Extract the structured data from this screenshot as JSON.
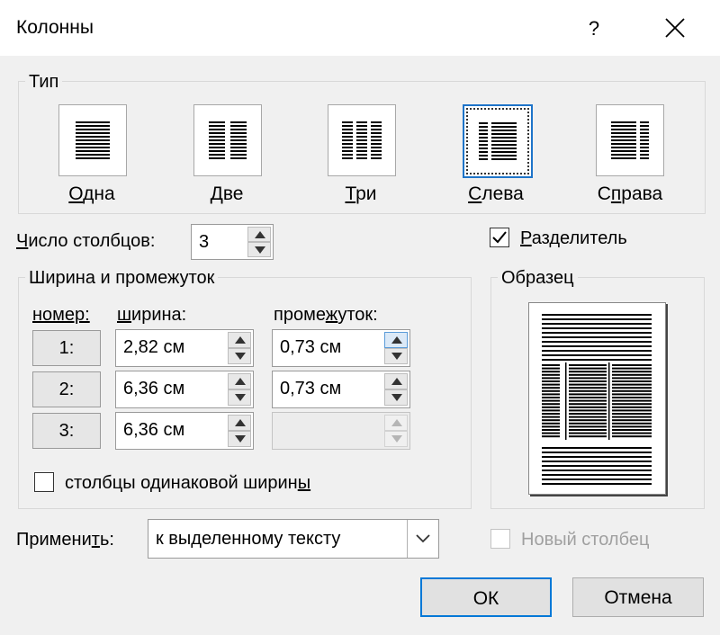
{
  "title": "Колонны",
  "help": "?",
  "type_group": {
    "legend": "Тип",
    "presets": [
      {
        "pre": "",
        "u": "О",
        "post": "дна"
      },
      {
        "pre": "",
        "u": "Д",
        "post": "ве"
      },
      {
        "pre": "",
        "u": "Т",
        "post": "ри"
      },
      {
        "pre": "",
        "u": "С",
        "post": "лева"
      },
      {
        "pre": "С",
        "u": "п",
        "post": "рава"
      }
    ],
    "selected": "Слева"
  },
  "num_columns": {
    "pre": "",
    "u": "Ч",
    "post": "исло столбцов:",
    "value": "3"
  },
  "separator": {
    "pre": "",
    "u": "Р",
    "post": "азделитель",
    "checked": true
  },
  "width_group": {
    "legend": "Ширина и промежуток",
    "col_num": "номер:",
    "col_width_u": "ш",
    "col_width_post": "ирина:",
    "col_gap_pre": "проме",
    "col_gap_u": "ж",
    "col_gap_post": "уток:",
    "rows": [
      {
        "num": "1:",
        "width": "2,82 см",
        "gap": "0,73 см"
      },
      {
        "num": "2:",
        "width": "6,36 см",
        "gap": "0,73 см"
      },
      {
        "num": "3:",
        "width": "6,36 см",
        "gap": ""
      }
    ],
    "equal_pre": "столбцы одинаковой ширин",
    "equal_u": "ы",
    "equal_checked": false
  },
  "sample": {
    "legend": "Образец"
  },
  "apply": {
    "pre": "Примени",
    "u": "т",
    "post": "ь:",
    "value": "к выделенному тексту"
  },
  "new_column": {
    "label": "Новый столбец",
    "checked": false,
    "enabled": false
  },
  "ok": "ОК",
  "cancel": "Отмена"
}
